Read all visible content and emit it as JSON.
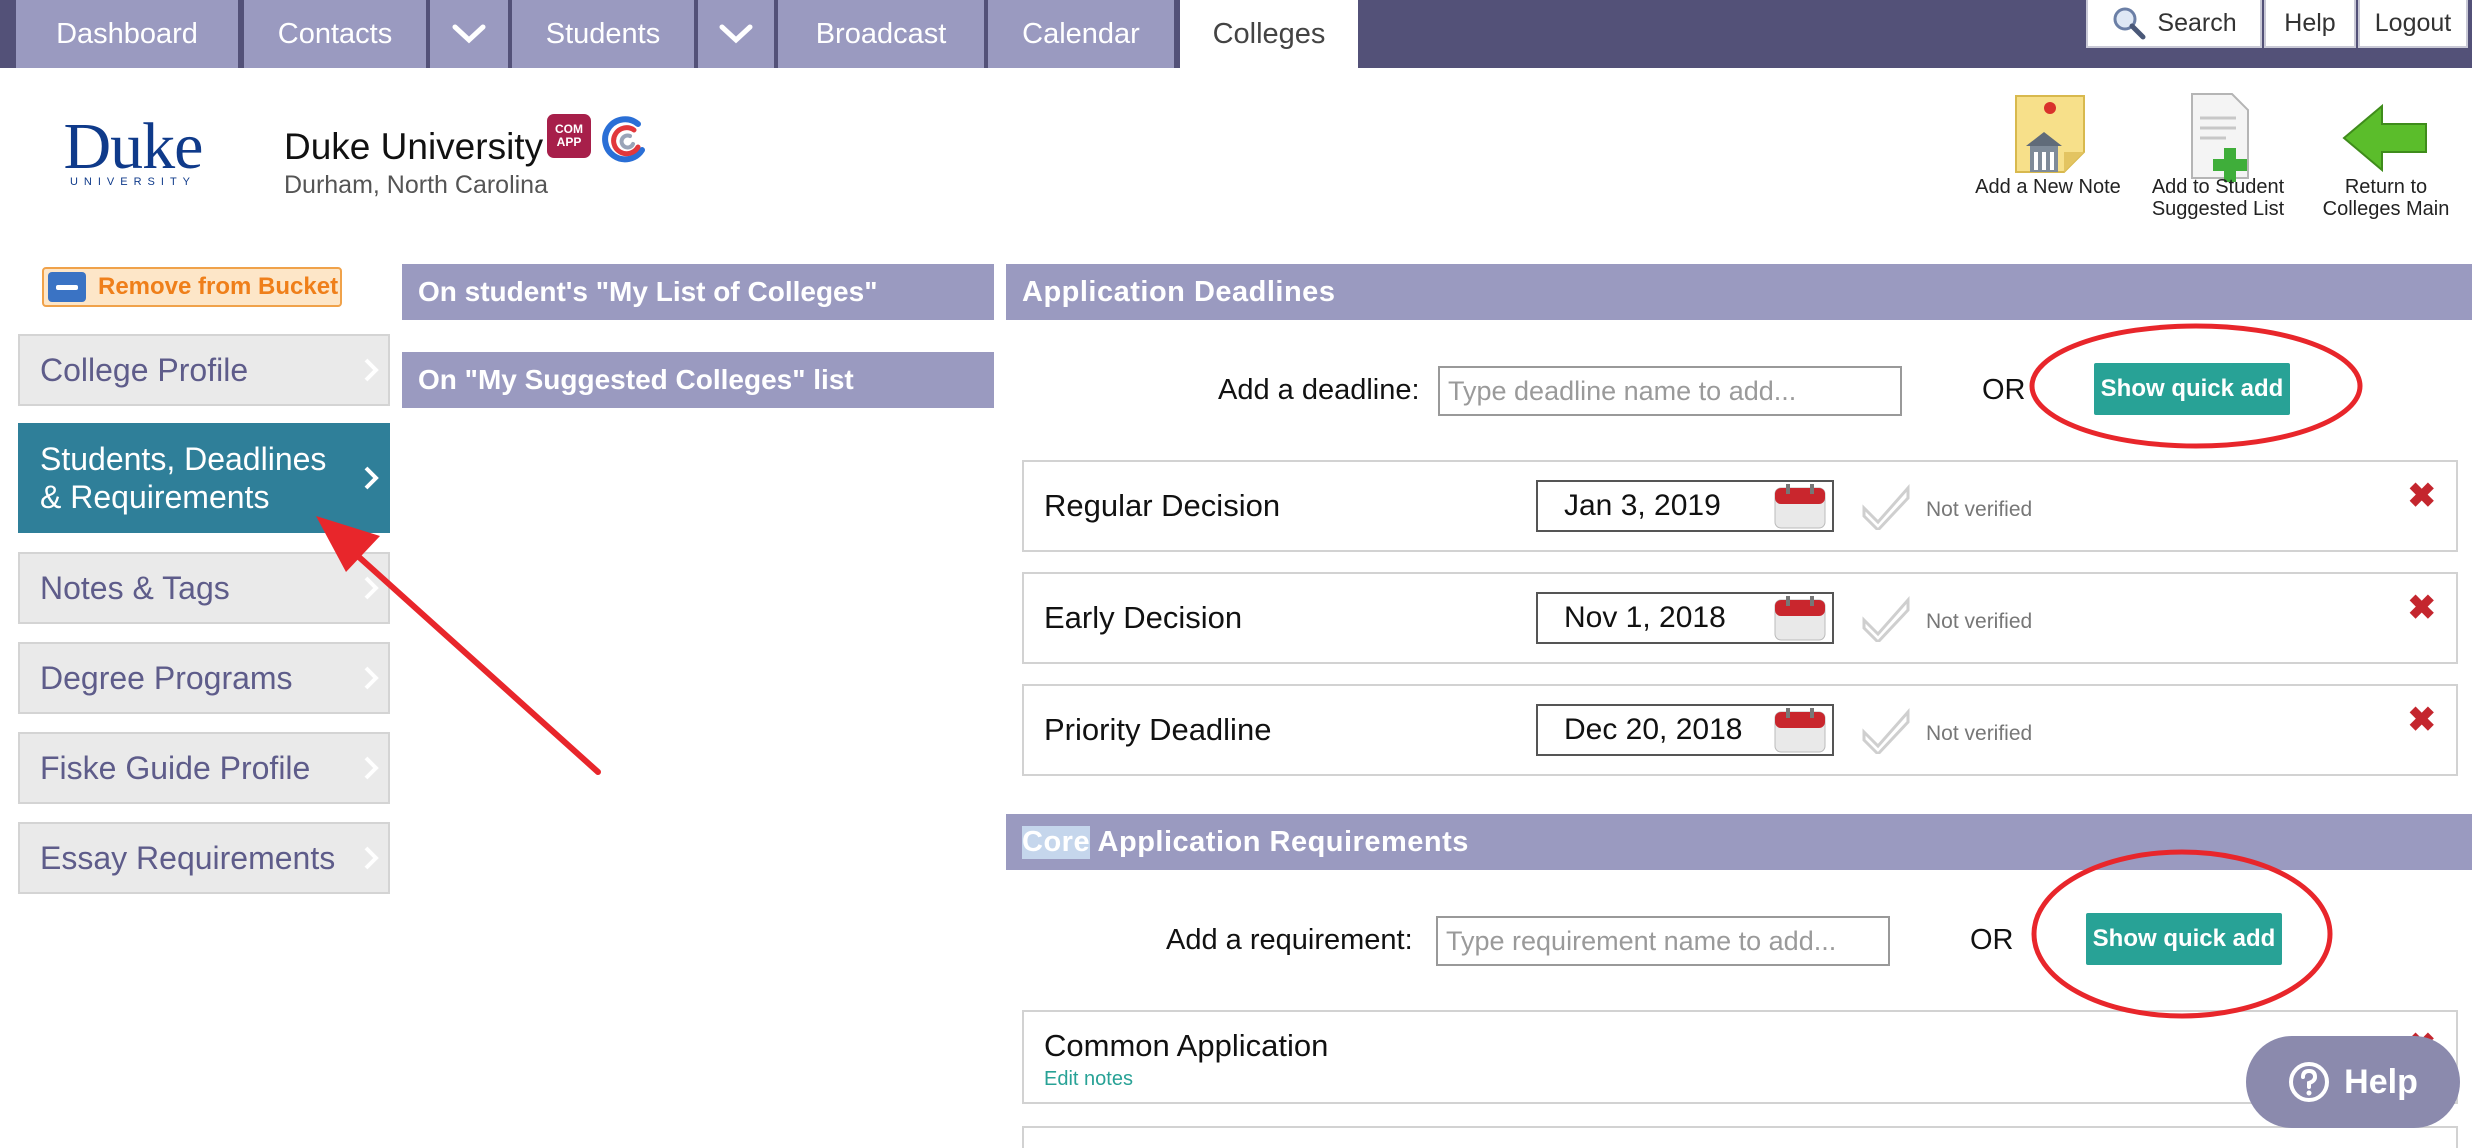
{
  "nav": {
    "tabs": [
      {
        "label": "Dashboard"
      },
      {
        "label": "Contacts"
      },
      {
        "label": "Students"
      },
      {
        "label": "Broadcast"
      },
      {
        "label": "Calendar"
      },
      {
        "label": "Colleges"
      }
    ],
    "active_tab": "Colleges",
    "utility": {
      "search": "Search",
      "help": "Help",
      "logout": "Logout"
    }
  },
  "college": {
    "logo_word": "Duke",
    "logo_sub": "UNIVERSITY",
    "name": "Duke University",
    "location": "Durham, North Carolina",
    "badge_commonapp": "COM APP"
  },
  "actions": {
    "add_note": "Add a New Note",
    "add_suggested": "Add to Student Suggested List",
    "return_main": "Return to Colleges Main"
  },
  "sidebar": {
    "bucket_label": "Remove from Bucket",
    "items": [
      {
        "label": "College Profile"
      },
      {
        "label": "Students, Deadlines & Requirements"
      },
      {
        "label": "Notes & Tags"
      },
      {
        "label": "Degree Programs"
      },
      {
        "label": "Fiske Guide Profile"
      },
      {
        "label": "Essay Requirements"
      }
    ],
    "active_item": "Students, Deadlines & Requirements"
  },
  "lists": {
    "my_list": "On student's \"My List of Colleges\"",
    "suggested": "On \"My Suggested Colleges\" list"
  },
  "deadlines": {
    "section_title": "Application Deadlines",
    "add_label": "Add a deadline:",
    "add_placeholder": "Type deadline name to add...",
    "or": "OR",
    "quick_add": "Show quick add",
    "rows": [
      {
        "name": "Regular Decision",
        "date": "Jan 3, 2019",
        "status": "Not verified"
      },
      {
        "name": "Early Decision",
        "date": "Nov 1, 2018",
        "status": "Not verified"
      },
      {
        "name": "Priority Deadline",
        "date": "Dec 20, 2018",
        "status": "Not verified"
      }
    ],
    "delete_glyph": "✖"
  },
  "requirements": {
    "section_title_highlight": "Core",
    "section_title_rest": " Application Requirements",
    "add_label": "Add a requirement:",
    "add_placeholder": "Type requirement name to add...",
    "or": "OR",
    "quick_add": "Show quick add",
    "rows": [
      {
        "name": "Common Application",
        "edit": "Edit notes"
      }
    ]
  },
  "help_fab": {
    "label": "Help"
  },
  "colors": {
    "topbar": "#535178",
    "nav_tab": "#9a9ac0",
    "active_side": "#2f7f99",
    "teal_button": "#28a296",
    "annotation_red": "#e8262b"
  }
}
